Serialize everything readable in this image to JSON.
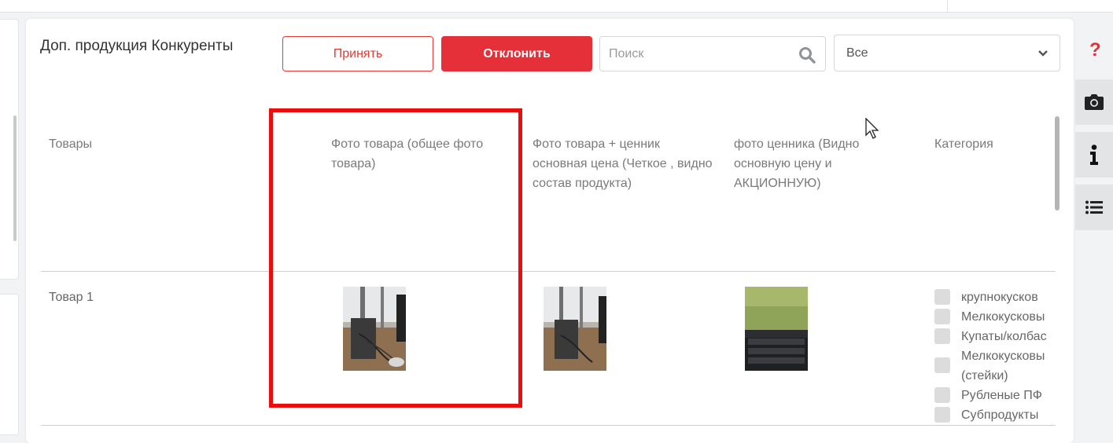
{
  "header": {
    "title": "Доп. продукция Конкуренты",
    "accept_label": "Принять",
    "reject_label": "Отклонить",
    "search_placeholder": "Поиск",
    "filter_value": "Все"
  },
  "table": {
    "columns": [
      "Товары",
      "Фото товара (общее фото товара)",
      "Фото товара + ценник основная цена (Четкое , видно состав продукта)",
      "фото ценника (Видно основную цену и АКЦИОННУЮ)",
      "Категория"
    ],
    "rows": [
      {
        "name": "Товар 1",
        "categories": [
          "крупнокусков",
          "Мелкокусковы",
          "Купаты/колбас",
          "Мелкокусковы (стейки)",
          "Рубленые ПФ",
          "Субпродукты"
        ]
      }
    ]
  },
  "sidebar": {
    "help_glyph": "?",
    "icons": [
      "camera-icon",
      "info-icon",
      "list-icon"
    ]
  },
  "colors": {
    "accent": "#e5303a",
    "highlight": "#ea0d0d"
  }
}
